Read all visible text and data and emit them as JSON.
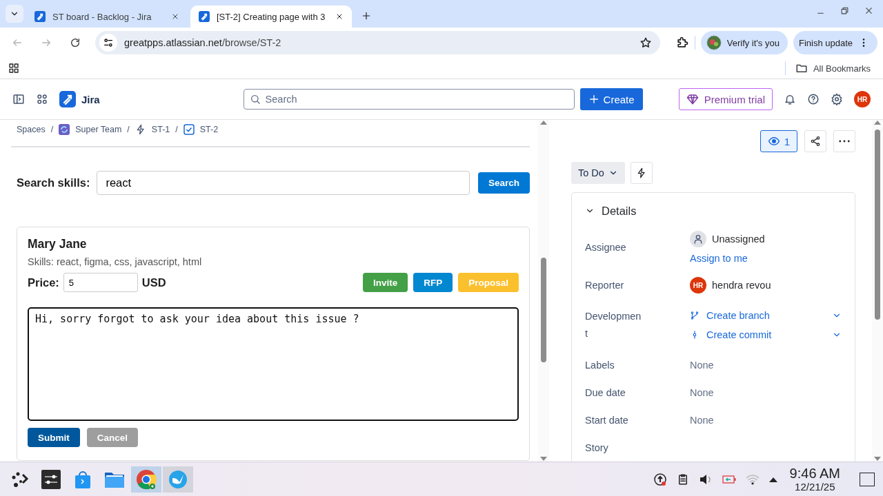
{
  "browser": {
    "tabs": [
      {
        "title": "ST board - Backlog - Jira",
        "selected": false
      },
      {
        "title": "[ST-2] Creating page with 3",
        "selected": true
      }
    ],
    "url_host": "greatpps.atlassian.net",
    "url_path": "/browse/ST-2",
    "verify": "Verify it's you",
    "update": "Finish update",
    "bookmarks": "All Bookmarks"
  },
  "jira": {
    "product": "Jira",
    "search_placeholder": "Search",
    "create": "Create",
    "premium": "Premium trial",
    "avatar": "HR"
  },
  "breadcrumbs": [
    {
      "label": "Spaces",
      "kind": "plain"
    },
    {
      "separator": "/",
      "label": "Super Team",
      "kind": "space"
    },
    {
      "separator": "/",
      "label": "ST-1",
      "kind": "epic"
    },
    {
      "separator": "/",
      "label": "ST-2",
      "kind": "task"
    }
  ],
  "skill_search": {
    "label": "Search skills:",
    "value": "react",
    "button": "Search"
  },
  "candidate": {
    "name": "Mary Jane",
    "skills": "Skills: react, figma, css, javascript, html",
    "price_label": "Price:",
    "price": "5",
    "currency": "USD",
    "actions": [
      {
        "label": "Invite",
        "kind": "invite"
      },
      {
        "label": "RFP",
        "kind": "rfp"
      },
      {
        "label": "Proposal",
        "kind": "proposal"
      }
    ],
    "message": "Hi, sorry forgot to ask your idea about this issue ?",
    "submit": "Submit",
    "cancel": "Cancel"
  },
  "issue": {
    "watchers": "1",
    "status": "To Do",
    "details": {
      "title": "Details",
      "expanded": true,
      "fields": [
        {
          "label": "Assignee",
          "kind": "user",
          "value": "Unassigned",
          "link": "Assign to me"
        },
        {
          "label": "Reporter",
          "kind": "avatar",
          "initials": "HR",
          "value": "hendra revou"
        },
        {
          "label": "Development",
          "kind": "dev",
          "actions": [
            "Create branch",
            "Create commit"
          ]
        },
        {
          "label": "Labels",
          "kind": "text",
          "value": "None"
        },
        {
          "label": "Due date",
          "kind": "text",
          "value": "None"
        },
        {
          "label": "Start date",
          "kind": "text",
          "value": "None"
        },
        {
          "label": "Story",
          "kind": "text"
        }
      ]
    }
  },
  "taskbar": {
    "apps": [
      {
        "kind": "launcher",
        "active": false
      },
      {
        "kind": "settings",
        "active": false
      },
      {
        "kind": "store",
        "active": false
      },
      {
        "kind": "files",
        "active": false
      },
      {
        "kind": "chrome",
        "active": true
      },
      {
        "kind": "bird",
        "active": true
      }
    ],
    "time": "9:46 AM",
    "date": "12/21/25"
  }
}
